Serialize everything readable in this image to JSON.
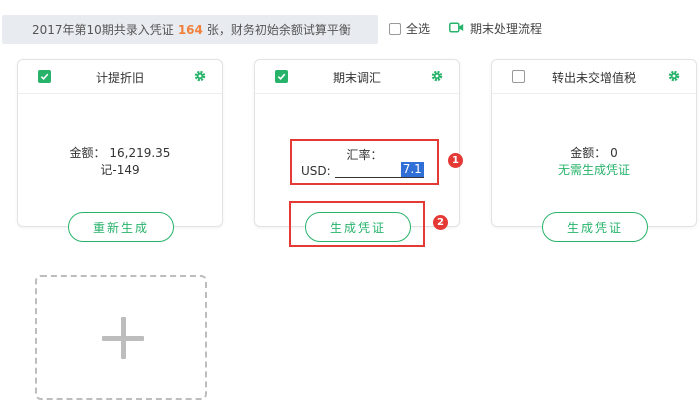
{
  "header": {
    "summary_prefix": "2017年第10期共录入凭证",
    "voucher_count": "164",
    "summary_suffix": "张，财务初始余额试算平衡",
    "select_all_label": "全选",
    "flow_label": "期末处理流程"
  },
  "cards": [
    {
      "title": "计提折旧",
      "checked": true,
      "amount_line": "金额： 16,219.35",
      "voucher_line": "记-149",
      "button_label": "重新生成"
    },
    {
      "title": "期末调汇",
      "checked": true,
      "rate_label": "汇率：",
      "currency": "USD:",
      "rate_value": "7.1",
      "button_label": "生成凭证"
    },
    {
      "title": "转出未交增值税",
      "checked": false,
      "amount_line": "金额： 0",
      "status_line": "无需生成凭证",
      "button_label": "生成凭证"
    }
  ],
  "annotations": [
    "1",
    "2"
  ],
  "colors": {
    "accent": "#28b36b",
    "highlight": "#e53935",
    "count": "#f0803c",
    "selection": "#2f6fd6"
  },
  "icons": [
    "checkbox-icon",
    "video-camera-icon",
    "gear-icon",
    "plus-icon"
  ]
}
